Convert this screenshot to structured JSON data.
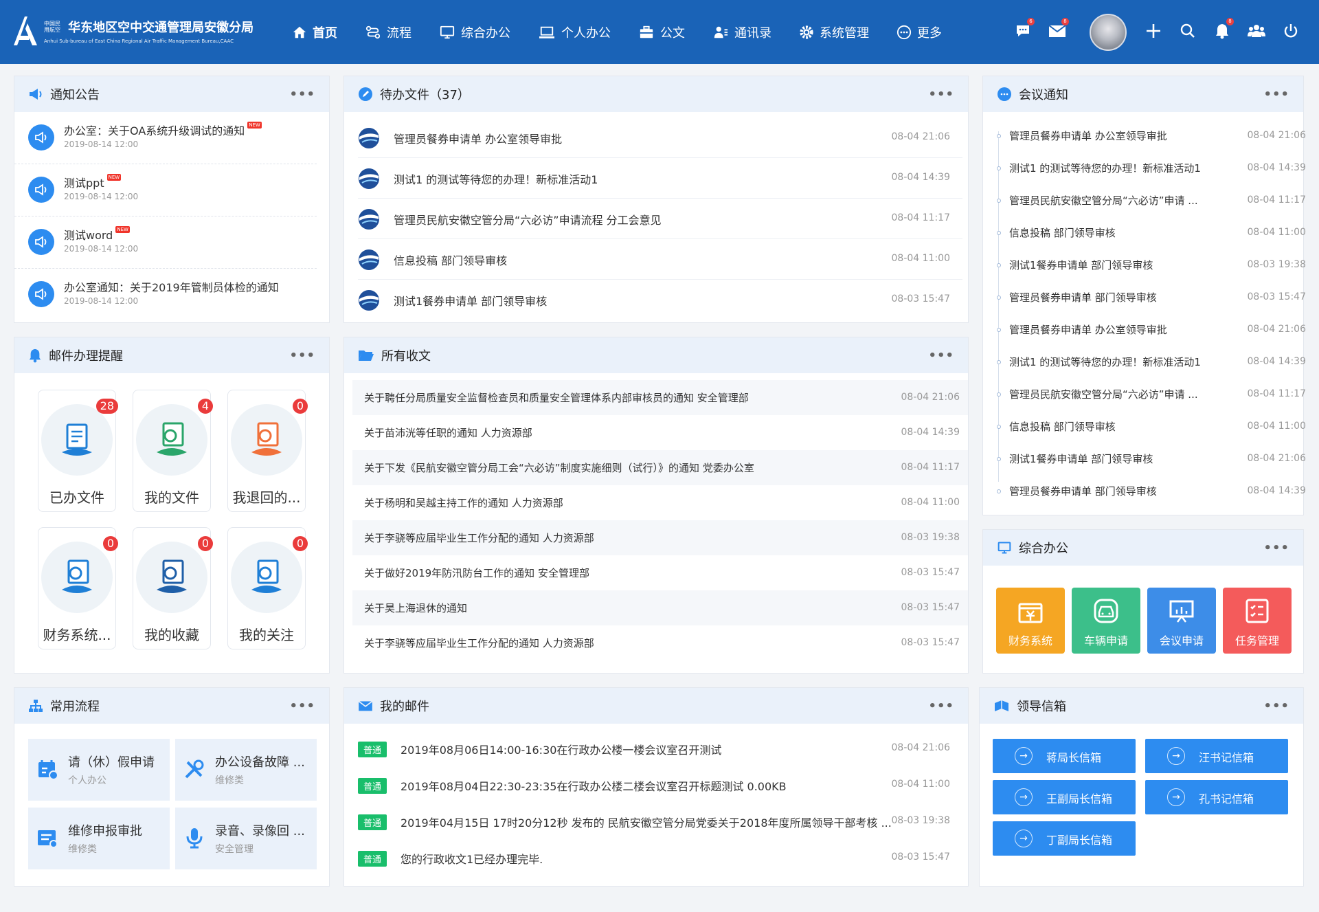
{
  "header": {
    "org_small": "中国民用航空",
    "title": "华东地区空中交通管理局安徽分局",
    "subtitle_en": "Anhui Sub-bureau of East China Regional Air Traffic Management Bureau,CAAC",
    "nav": [
      {
        "label": "首页",
        "icon": "home-icon",
        "active": true
      },
      {
        "label": "流程",
        "icon": "flow-icon",
        "active": false
      },
      {
        "label": "综合办公",
        "icon": "monitor-icon",
        "active": false
      },
      {
        "label": "个人办公",
        "icon": "laptop-icon",
        "active": false
      },
      {
        "label": "公文",
        "icon": "briefcase-icon",
        "active": false
      },
      {
        "label": "通讯录",
        "icon": "contacts-icon",
        "active": false
      },
      {
        "label": "系统管理",
        "icon": "gear-icon",
        "active": false
      },
      {
        "label": "更多",
        "icon": "more-circle-icon",
        "active": false
      }
    ],
    "right_badges": {
      "message": "6",
      "mail": "8",
      "bell": "8"
    },
    "accent": "#1a63b7"
  },
  "notice": {
    "title": "通知公告",
    "more": "•••",
    "items": [
      {
        "title": "办公室：关于OA系统升级调试的通知",
        "date": "2019-08-14   12:00",
        "new": "NEW"
      },
      {
        "title": "测试ppt",
        "date": "2019-08-14   12:00",
        "new": "NEW"
      },
      {
        "title": "测试word",
        "date": "2019-08-14   12:00",
        "new": "NEW"
      },
      {
        "title": "办公室通知：关于2019年管制员体检的通知",
        "date": "2019-08-14   12:00",
        "new": ""
      }
    ]
  },
  "todo": {
    "title": "待办文件（37）",
    "more": "•••",
    "items": [
      {
        "text": "管理员餐券申请单 办公室领导审批",
        "time": "08-04 21:06"
      },
      {
        "text": "测试1 的测试等待您的办理！新标准活动1",
        "time": "08-04 14:39"
      },
      {
        "text": "管理员民航安徽空管分局“六必访”申请流程 分工会意见",
        "time": "08-04 11:17"
      },
      {
        "text": "信息投稿 部门领导审核",
        "time": "08-04 11:00"
      },
      {
        "text": "测试1餐券申请单 部门领导审核",
        "time": "08-03 15:47"
      }
    ]
  },
  "meeting": {
    "title": "会议通知",
    "more": "•••",
    "items": [
      {
        "text": "管理员餐券申请单 办公室领导审批",
        "time": "08-04 21:06"
      },
      {
        "text": "测试1 的测试等待您的办理！新标准活动1",
        "time": "08-04 14:39"
      },
      {
        "text": "管理员民航安徽空管分局“六必访”申请 ...",
        "time": "08-04 11:17"
      },
      {
        "text": "信息投稿 部门领导审核",
        "time": "08-04 11:00"
      },
      {
        "text": "测试1餐券申请单 部门领导审核",
        "time": "08-03 19:38"
      },
      {
        "text": "管理员餐券申请单 部门领导审核",
        "time": "08-03 15:47"
      },
      {
        "text": "管理员餐券申请单 办公室领导审批",
        "time": "08-04 21:06"
      },
      {
        "text": "测试1 的测试等待您的办理！新标准活动1",
        "time": "08-04 14:39"
      },
      {
        "text": "管理员民航安徽空管分局“六必访”申请 ...",
        "time": "08-04 11:17"
      },
      {
        "text": "信息投稿 部门领导审核",
        "time": "08-04 11:00"
      },
      {
        "text": "测试1餐券申请单 部门领导审核",
        "time": "08-04 21:06"
      },
      {
        "text": "管理员餐券申请单 部门领导审核",
        "time": "08-04 14:39"
      }
    ]
  },
  "mail_remind": {
    "title": "邮件办理提醒",
    "more": "•••",
    "cards": [
      {
        "label": "已办文件",
        "count": "28",
        "color": "#1f7fd6"
      },
      {
        "label": "我的文件",
        "count": "4",
        "color": "#2aa56a"
      },
      {
        "label": "我退回的...",
        "count": "0",
        "color": "#f0703a"
      },
      {
        "label": "财务系统...",
        "count": "0",
        "color": "#1f7fd6"
      },
      {
        "label": "我的收藏",
        "count": "0",
        "color": "#1f5fa8"
      },
      {
        "label": "我的关注",
        "count": "0",
        "color": "#1f7fd6"
      }
    ]
  },
  "received": {
    "title": "所有收文",
    "more": "•••",
    "items": [
      {
        "text": "关于聘任分局质量安全监督检查员和质量安全管理体系内部审核员的通知 安全管理部",
        "time": "08-04 21:06"
      },
      {
        "text": "关于苗沛洸等任职的通知 人力资源部",
        "time": "08-04 14:39"
      },
      {
        "text": "关于下发《民航安徽空管分局工会“六必访”制度实施细则（试行）》的通知 党委办公室",
        "time": "08-04 11:17"
      },
      {
        "text": "关于杨明和吴越主持工作的通知 人力资源部",
        "time": "08-04 11:00"
      },
      {
        "text": "关于李骁等应届毕业生工作分配的通知 人力资源部",
        "time": "08-03 19:38"
      },
      {
        "text": "关于做好2019年防汛防台工作的通知 安全管理部",
        "time": "08-03 15:47"
      },
      {
        "text": "关于昊上海退休的通知",
        "time": "08-03 15:47"
      },
      {
        "text": "关于李骁等应届毕业生工作分配的通知 人力资源部",
        "time": "08-03 15:47"
      }
    ]
  },
  "office": {
    "title": "综合办公",
    "more": "•••",
    "tiles": [
      {
        "label": "财务系统",
        "color": "#f5a623"
      },
      {
        "label": "车辆申请",
        "color": "#3cbf8a"
      },
      {
        "label": "会议申请",
        "color": "#3d8de8"
      },
      {
        "label": "任务管理",
        "color": "#f45b5b"
      }
    ]
  },
  "flows": {
    "title": "常用流程",
    "more": "•••",
    "items": [
      {
        "title": "请（休）假申请",
        "sub": "个人办公"
      },
      {
        "title": "办公设备故障 ...",
        "sub": "维修类"
      },
      {
        "title": "维修申报审批",
        "sub": "维修类"
      },
      {
        "title": "录音、录像回 ...",
        "sub": "安全管理"
      }
    ]
  },
  "my_mail": {
    "title": "我的邮件",
    "more": "•••",
    "items": [
      {
        "tag": "普通",
        "text": "2019年08月06日14:00-16:30在行政办公楼一楼会议室召开测试",
        "time": "08-04 21:06"
      },
      {
        "tag": "普通",
        "text": "2019年08月04日22:30-23:35在行政办公楼二楼会议室召开标题测试 0.00KB",
        "time": "08-04 11:00"
      },
      {
        "tag": "普通",
        "text": "2019年04月15日 17时20分12秒 发布的 民航安徽空管分局党委关于2018年度所属领导干部考核 ...",
        "time": "08-03 19:38"
      },
      {
        "tag": "普通",
        "text": "您的行政收文1已经办理完毕.",
        "time": "08-03 15:47"
      }
    ]
  },
  "leader_box": {
    "title": "领导信箱",
    "more": "•••",
    "items": [
      "蒋局长信箱",
      "汪书记信箱",
      "王副局长信箱",
      "孔书记信箱",
      "丁副局长信箱"
    ]
  }
}
